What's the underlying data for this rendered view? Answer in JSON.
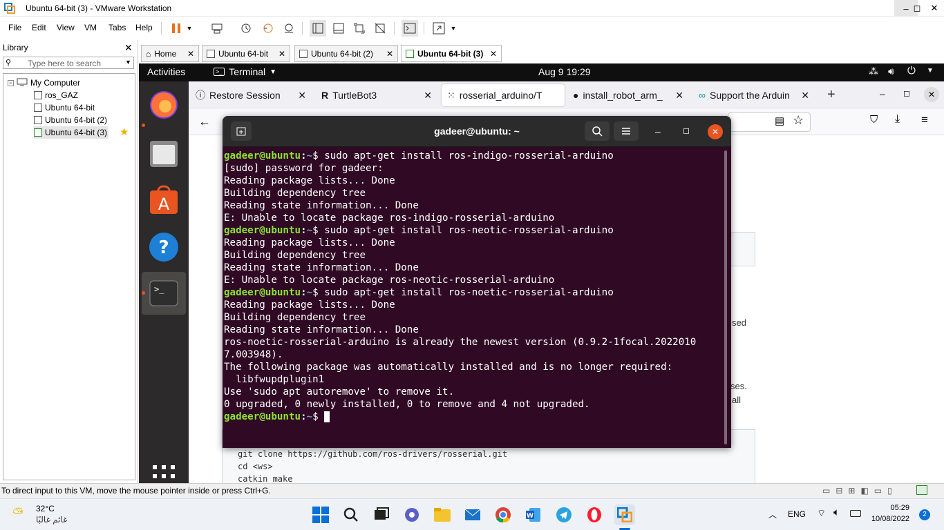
{
  "window": {
    "title": "Ubuntu 64-bit (3) - VMware Workstation"
  },
  "menu": [
    "File",
    "Edit",
    "View",
    "VM",
    "Tabs",
    "Help"
  ],
  "library": {
    "title": "Library",
    "search_placeholder": "Type here to search",
    "root": "My Computer",
    "items": [
      "ros_GAZ",
      "Ubuntu 64-bit",
      "Ubuntu 64-bit (2)",
      "Ubuntu 64-bit (3)"
    ]
  },
  "vm_tabs": [
    "Home",
    "Ubuntu 64-bit",
    "Ubuntu 64-bit (2)",
    "Ubuntu 64-bit (3)"
  ],
  "gnome": {
    "activities": "Activities",
    "app": "Terminal",
    "clock": "Aug 9  19:29"
  },
  "firefox": {
    "tabs": [
      "Restore Session",
      "TurtleBot3",
      "rosserial_arduino/T",
      "install_robot_arm_",
      "Support the Arduin"
    ],
    "page_fragments": [
      "sed",
      "ses.",
      "all"
    ],
    "code_lines": [
      "git clone https://github.com/ros-drivers/rosserial.git",
      "cd <ws>",
      "catkin_make"
    ]
  },
  "terminal": {
    "title": "gadeer@ubuntu: ~",
    "prompt_user": "gadeer@ubuntu",
    "prompt_path": "~",
    "lines": [
      {
        "type": "cmd",
        "text": "$ sudo apt-get install ros-indigo-rosserial-arduino"
      },
      {
        "type": "out",
        "text": "[sudo] password for gadeer:"
      },
      {
        "type": "out",
        "text": "Reading package lists... Done"
      },
      {
        "type": "out",
        "text": "Building dependency tree"
      },
      {
        "type": "out",
        "text": "Reading state information... Done"
      },
      {
        "type": "out",
        "text": "E: Unable to locate package ros-indigo-rosserial-arduino"
      },
      {
        "type": "cmd",
        "text": "$ sudo apt-get install ros-neotic-rosserial-arduino"
      },
      {
        "type": "out",
        "text": "Reading package lists... Done"
      },
      {
        "type": "out",
        "text": "Building dependency tree"
      },
      {
        "type": "out",
        "text": "Reading state information... Done"
      },
      {
        "type": "out",
        "text": "E: Unable to locate package ros-neotic-rosserial-arduino"
      },
      {
        "type": "cmd",
        "text": "$ sudo apt-get install ros-noetic-rosserial-arduino"
      },
      {
        "type": "out",
        "text": "Reading package lists... Done"
      },
      {
        "type": "out",
        "text": "Building dependency tree"
      },
      {
        "type": "out",
        "text": "Reading state information... Done"
      },
      {
        "type": "out",
        "text": "ros-noetic-rosserial-arduino is already the newest version (0.9.2-1focal.2022010"
      },
      {
        "type": "out",
        "text": "7.003948)."
      },
      {
        "type": "out",
        "text": "The following package was automatically installed and is no longer required:"
      },
      {
        "type": "out",
        "text": "  libfwupdplugin1"
      },
      {
        "type": "out",
        "text": "Use 'sudo apt autoremove' to remove it."
      },
      {
        "type": "out",
        "text": "0 upgraded, 0 newly installed, 0 to remove and 4 not upgraded."
      },
      {
        "type": "cmd",
        "text": "$ "
      }
    ]
  },
  "status": {
    "text": "To direct input to this VM, move the mouse pointer inside or press Ctrl+G."
  },
  "taskbar": {
    "weather_temp": "32°C",
    "weather_desc": "غائم غالبًا",
    "lang": "ENG",
    "time": "05:29",
    "date": "10/08/2022",
    "notifications": "2"
  }
}
